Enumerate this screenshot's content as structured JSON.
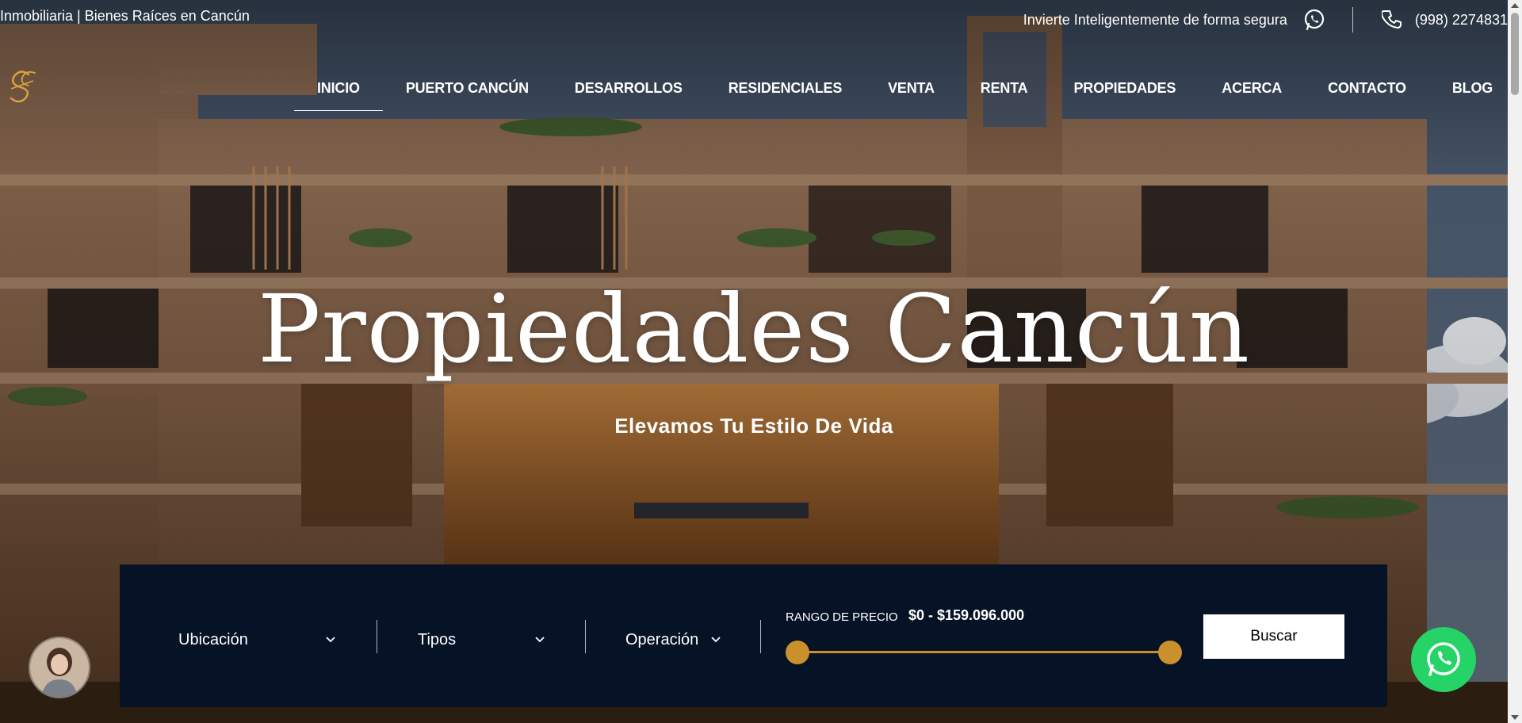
{
  "topbar": {
    "site_label": "Inmobiliaria | Bienes Raíces en Cancún",
    "tagline": "Invierte Inteligentemente de forma segura",
    "phone": "(998) 2274831"
  },
  "nav": {
    "items": [
      "INICIO",
      "PUERTO CANCÚN",
      "DESARROLLOS",
      "RESIDENCIALES",
      "VENTA",
      "RENTA",
      "PROPIEDADES",
      "ACERCA",
      "CONTACTO",
      "BLOG"
    ],
    "active": "INICIO"
  },
  "hero": {
    "title": "Propiedades Cancún",
    "subtitle": "Elevamos Tu Estilo De Vida"
  },
  "search": {
    "location_label": "Ubicación",
    "types_label": "Tipos",
    "operation_label": "Operación",
    "price_range_label": "RANGO DE PRECIO",
    "price_range_value": "$0 - $159.096.000",
    "slider_min_fraction": 0,
    "slider_max_fraction": 1,
    "submit_label": "Buscar"
  },
  "colors": {
    "panel_bg": "#061226",
    "accent_gold": "#c9902b",
    "whatsapp_green": "#25d366"
  },
  "icons": [
    "whatsapp-icon",
    "phone-icon",
    "logo-icon",
    "chevron-down-icon",
    "agent-avatar",
    "whatsapp-float-icon"
  ]
}
